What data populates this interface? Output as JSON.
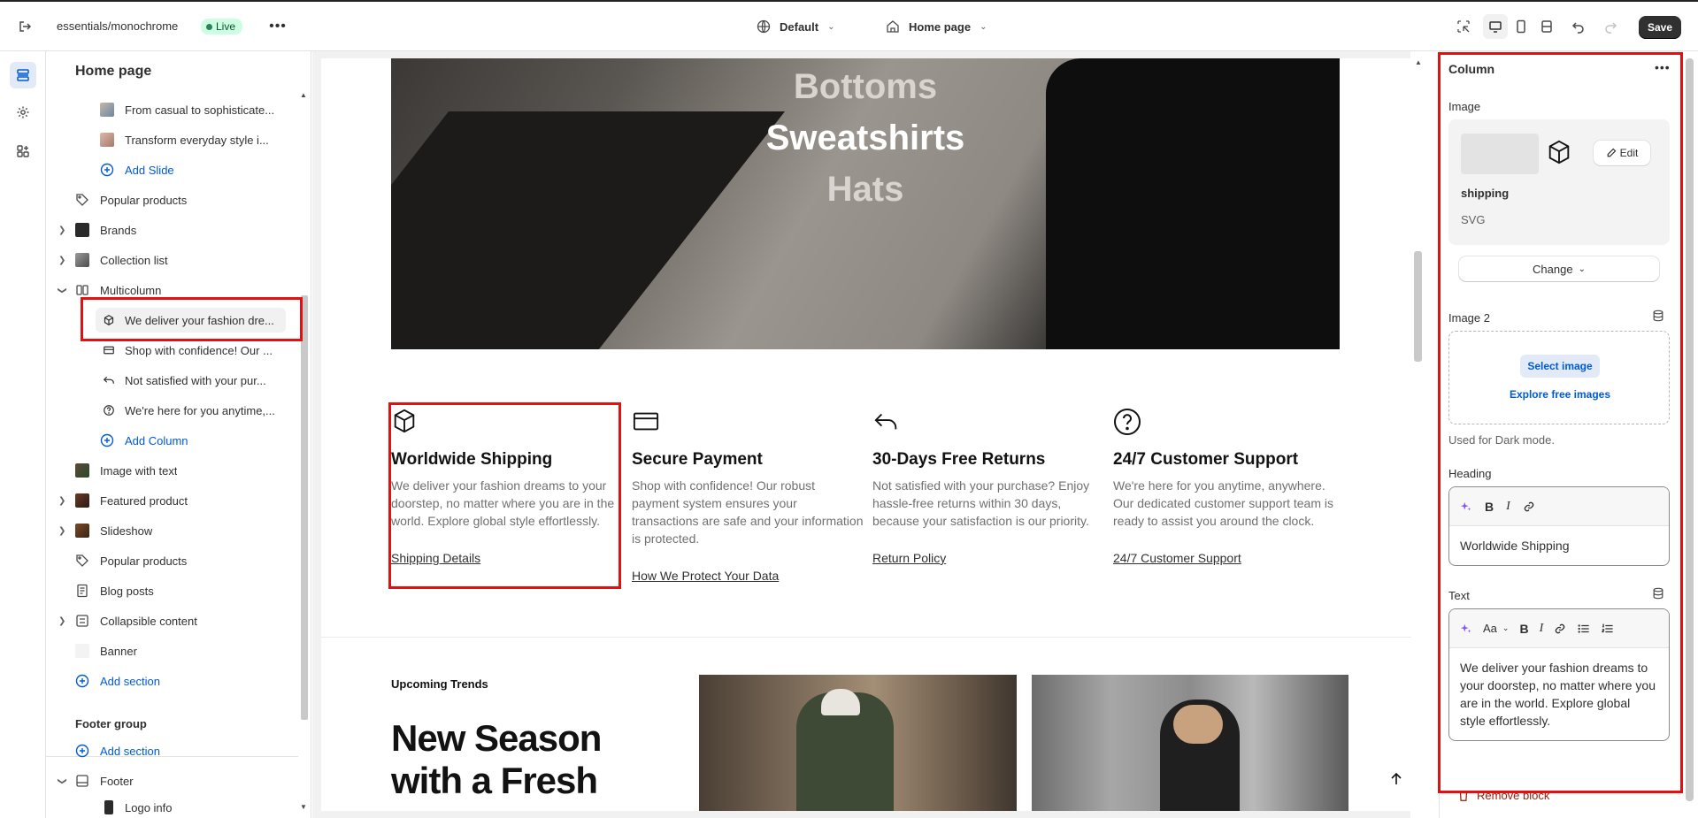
{
  "topbar": {
    "store_path": "essentials/monochrome",
    "live_badge": "Live",
    "theme_selector": "Default",
    "page_selector": "Home page",
    "save_label": "Save"
  },
  "sidebar": {
    "title": "Home page",
    "items": [
      {
        "label": "From casual to sophisticate..."
      },
      {
        "label": "Transform everyday style i..."
      },
      {
        "label": "Add Slide"
      },
      {
        "label": "Popular products"
      },
      {
        "label": "Brands"
      },
      {
        "label": "Collection list"
      },
      {
        "label": "Multicolumn"
      },
      {
        "label": "We deliver your fashion dre..."
      },
      {
        "label": "Shop with confidence! Our ..."
      },
      {
        "label": "Not satisfied with your pur..."
      },
      {
        "label": "We're here for you anytime,..."
      },
      {
        "label": "Add Column"
      },
      {
        "label": "Image with text"
      },
      {
        "label": "Featured product"
      },
      {
        "label": "Slideshow"
      },
      {
        "label": "Popular products"
      },
      {
        "label": "Blog posts"
      },
      {
        "label": "Collapsible content"
      },
      {
        "label": "Banner"
      },
      {
        "label": "Add section"
      }
    ],
    "footer_group": "Footer group",
    "footer_add_section": "Add section",
    "footer": "Footer",
    "logo_info": "Logo info"
  },
  "canvas": {
    "hero_words": [
      "Bottoms",
      "Sweatshirts",
      "Hats"
    ],
    "columns": [
      {
        "icon": "box-icon",
        "heading": "Worldwide Shipping",
        "text": "We deliver your fashion dreams to your doorstep, no matter where you are in the world. Explore global style effortlessly.",
        "link": "Shipping Details"
      },
      {
        "icon": "credit-card-icon",
        "heading": "Secure Payment",
        "text": "Shop with confidence! Our robust payment system ensures your transactions are safe and your information is protected.",
        "link": "How We Protect Your Data"
      },
      {
        "icon": "return-arrow-icon",
        "heading": "30-Days Free Returns",
        "text": "Not satisfied with your purchase? Enjoy hassle-free returns within 30 days, because your satisfaction is our priority.",
        "link": "Return Policy"
      },
      {
        "icon": "question-icon",
        "heading": "24/7 Customer Support",
        "text": "We're here for you anytime, anywhere. Our dedicated customer support team is ready to assist you around the clock.",
        "link": "24/7 Customer Support"
      }
    ],
    "upcoming": "Upcoming Trends",
    "season_line1": "New Season",
    "season_line2": "with a Fresh"
  },
  "inspector": {
    "title": "Column",
    "image_label": "Image",
    "image_name": "shipping",
    "image_type": "SVG",
    "edit_label": "Edit",
    "change_label": "Change",
    "image2_label": "Image 2",
    "select_image": "Select image",
    "explore_free": "Explore free images",
    "dark_mode_note": "Used for Dark mode.",
    "heading_label": "Heading",
    "heading_value": "Worldwide Shipping",
    "text_label": "Text",
    "text_value": "We deliver your fashion dreams to your doorstep, no matter where you are in the world. Explore global style effortlessly.",
    "remove_block": "Remove block"
  },
  "colors": {
    "accent": "#005bd3",
    "highlight": "#e60f0f",
    "live_bg": "#cdfee1"
  }
}
